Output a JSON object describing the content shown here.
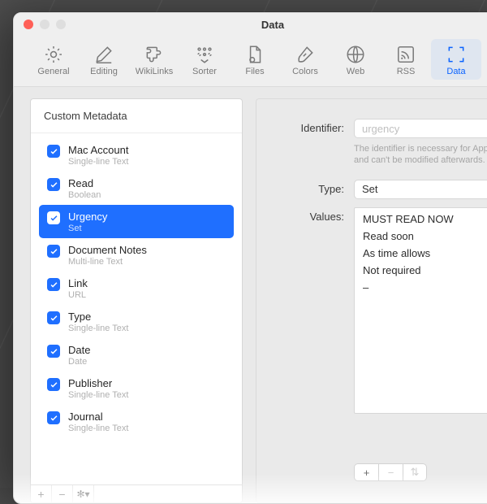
{
  "window": {
    "title": "Data"
  },
  "toolbar": {
    "items": [
      {
        "label": "General",
        "icon": "gear"
      },
      {
        "label": "Editing",
        "icon": "pencil"
      },
      {
        "label": "WikiLinks",
        "icon": "puzzle"
      },
      {
        "label": "Sorter",
        "icon": "sorter"
      },
      {
        "label": "Files",
        "icon": "file"
      },
      {
        "label": "Colors",
        "icon": "brush"
      },
      {
        "label": "Web",
        "icon": "globe"
      },
      {
        "label": "RSS",
        "icon": "rss"
      },
      {
        "label": "Data",
        "icon": "crop",
        "selected": true
      }
    ]
  },
  "sidebar": {
    "header": "Custom Metadata",
    "items": [
      {
        "label": "Mac Account",
        "sub": "Single-line Text"
      },
      {
        "label": "Read",
        "sub": "Boolean"
      },
      {
        "label": "Urgency",
        "sub": "Set",
        "selected": true
      },
      {
        "label": "Document Notes",
        "sub": "Multi-line Text"
      },
      {
        "label": "Link",
        "sub": "URL"
      },
      {
        "label": "Type",
        "sub": "Single-line Text"
      },
      {
        "label": "Date",
        "sub": "Date"
      },
      {
        "label": "Publisher",
        "sub": "Single-line Text"
      },
      {
        "label": "Journal",
        "sub": "Single-line Text"
      }
    ],
    "footer": {
      "add": "+",
      "remove": "−",
      "actions": "✻▾"
    }
  },
  "detail": {
    "identifier_label": "Identifier:",
    "identifier_value": "urgency",
    "identifier_hint": "The identifier is necessary for AppleScript and can't be modified afterwards.",
    "type_label": "Type:",
    "type_value": "Set",
    "values_label": "Values:",
    "values": [
      "MUST READ NOW",
      "Read soon",
      "As time allows",
      "Not required",
      "–"
    ],
    "footer": {
      "add": "+",
      "remove": "−",
      "sort": "⇅"
    }
  }
}
